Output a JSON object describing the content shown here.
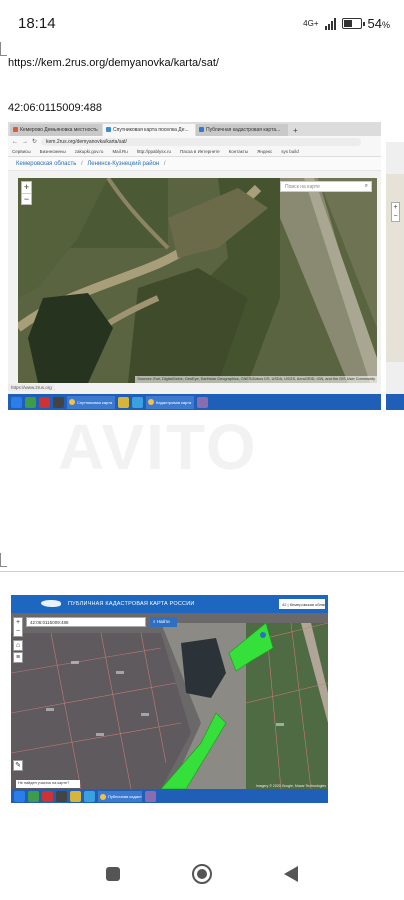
{
  "status_bar": {
    "time": "18:14",
    "network": "4G+",
    "battery_pct": "54",
    "battery_suffix": "%",
    "battery_level": 0.54
  },
  "message": {
    "url": "https://kem.2rus.org/demyanovka/karta/sat/",
    "cadastral_number": "42:06:0115009:488"
  },
  "screenshot1": {
    "tabs": [
      "Кемерово Демьяновка местность",
      "Спутниковая карта поселка Де...",
      "Публичная кадастровая карта..."
    ],
    "tab_add": "+",
    "address": "kem.2rus.org/demyanovka/karta/sat/",
    "bookmarks": [
      "Сервисы",
      "Бизнесмены",
      "zakupki.gov.ru",
      "Mail.Ru",
      "http://ppablysx.ru",
      "Пасха в Интернете",
      "Контакты",
      "Яндекс",
      "sys build"
    ],
    "breadcrumb_region": "Кемеровская область",
    "breadcrumb_separator": "/",
    "breadcrumb_district": "Ленинск-Кузнецкий район",
    "breadcrumb_trail": "/",
    "search_placeholder": "Поиск на карте",
    "attribution": "Sources: Esri, DigitalGlobe, GeoEye, Earthstar Geographics, CNES/Airbus DS, USDA, USGS, AeroGRID, IGN, and the GIS User Community",
    "status_url": "https://www.2rus.org",
    "taskbar": [
      "Спутниковая карта",
      "Кадастровая карта"
    ]
  },
  "screenshot2": {
    "title": "ПУБЛИЧНАЯ КАДАСТРОВАЯ КАРТА РОССИИ",
    "region": "42 | Кемеровская область",
    "search_value": "42:06:0115009:488",
    "find_button": "Найти",
    "hint": "Не найден участок на карте?",
    "attribution": "Imagery © 2020 Google, Maxar Technologies",
    "taskbar": [
      "Публичная кадастровая"
    ]
  },
  "watermark": "AVITO",
  "colors": {
    "taskbar": "#1f5fb7",
    "pkk_header": "#1d67c0",
    "parcel_green": "#35e03a"
  }
}
